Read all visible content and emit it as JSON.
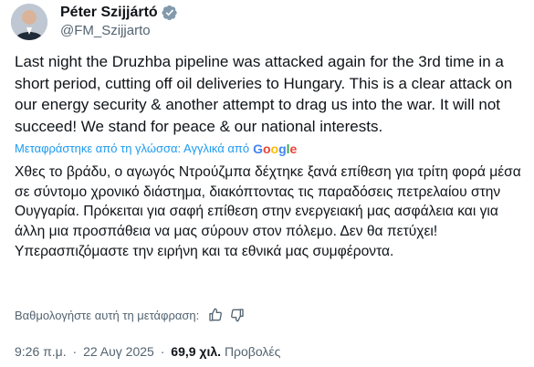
{
  "author": {
    "name": "Péter Szijjártó",
    "handle": "@FM_Szijjarto"
  },
  "tweet": {
    "text_en": "Last night the Druzhba pipeline was attacked again for the 3rd time in a short period, cutting off oil deliveries to Hungary. This is a clear attack on our energy security & another attempt to drag us into the war. It will not succeed! We stand for peace & our national interests.",
    "translation_note": "Μεταφράστηκε από τη γλώσσα: Αγγλικά από",
    "translation_provider": "Google",
    "text_el": "Χθες το βράδυ, ο αγωγός Ντρούζμπα δέχτηκε ξανά επίθεση για τρίτη φορά μέσα σε σύντομο χρονικό διάστημα, διακόπτοντας τις παραδόσεις πετρελαίου στην Ουγγαρία. Πρόκειται για σαφή επίθεση στην ενεργειακή μας ασφάλεια και για άλλη μια προσπάθεια να μας σύρουν στον πόλεμο. Δεν θα πετύχει! Υπερασπιζόμαστε την ειρήνη και τα εθνικά μας συμφέροντα.",
    "rate_translation_label": "Βαθμολογήστε αυτή τη μετάφραση:"
  },
  "meta": {
    "time": "9:26 π.μ.",
    "separator": "·",
    "date": "22 Αυγ 2025",
    "views_count": "69,9 χιλ.",
    "views_label": "Προβολές"
  },
  "colors": {
    "accent": "#1d9bf0",
    "secondary_text": "#536471",
    "primary_text": "#0f1419"
  },
  "icons": {
    "verified": "verified-badge-icon",
    "thumbs_up": "thumbs-up-icon",
    "thumbs_down": "thumbs-down-icon"
  }
}
